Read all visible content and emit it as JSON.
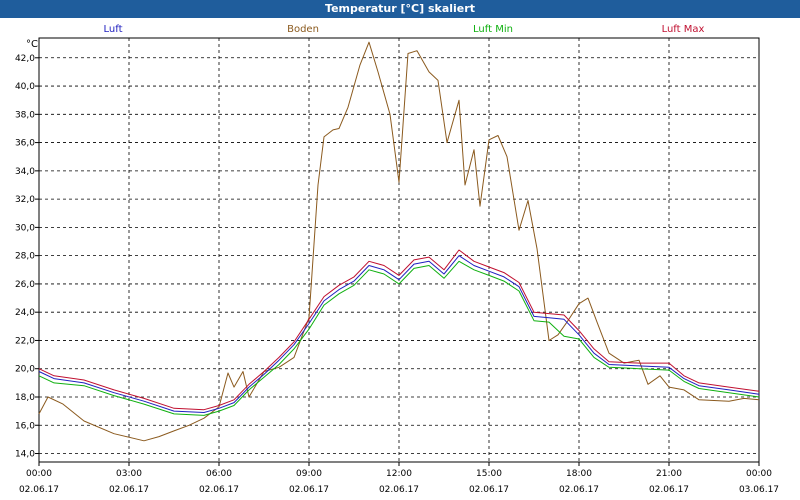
{
  "window": {
    "title": "Temperatur [°C] skaliert"
  },
  "chart_data": {
    "type": "line",
    "title": "Temperatur [°C] skaliert",
    "y_unit": "°C",
    "ylim": [
      13.4,
      43.4
    ],
    "yticks": [
      14,
      16,
      18,
      20,
      22,
      24,
      26,
      28,
      30,
      32,
      34,
      36,
      38,
      40,
      42
    ],
    "ytick_labels": [
      "14,0",
      "16,0",
      "18,0",
      "20,0",
      "22,0",
      "24,0",
      "26,0",
      "28,0",
      "30,0",
      "32,0",
      "34,0",
      "36,0",
      "38,0",
      "40,0",
      "42,0"
    ],
    "xlim_hours": [
      0,
      24
    ],
    "xticks": [
      {
        "time": "00:00",
        "date": "02.06.17"
      },
      {
        "time": "03:00",
        "date": "02.06.17"
      },
      {
        "time": "06:00",
        "date": "02.06.17"
      },
      {
        "time": "09:00",
        "date": "02.06.17"
      },
      {
        "time": "12:00",
        "date": "02.06.17"
      },
      {
        "time": "15:00",
        "date": "02.06.17"
      },
      {
        "time": "18:00",
        "date": "02.06.17"
      },
      {
        "time": "21:00",
        "date": "02.06.17"
      },
      {
        "time": "00:00",
        "date": "03.06.17"
      }
    ],
    "grid": true,
    "legend_position": "top",
    "series": [
      {
        "name": "Luft",
        "color": "#2020c0",
        "points": [
          [
            0,
            19.8
          ],
          [
            0.5,
            19.3
          ],
          [
            1.5,
            19.0
          ],
          [
            2.5,
            18.3
          ],
          [
            3.5,
            17.7
          ],
          [
            4.5,
            17.0
          ],
          [
            5.5,
            16.9
          ],
          [
            6.0,
            17.2
          ],
          [
            6.5,
            17.6
          ],
          [
            7.0,
            18.7
          ],
          [
            7.5,
            19.6
          ],
          [
            8.0,
            20.6
          ],
          [
            8.5,
            21.7
          ],
          [
            9.0,
            23.2
          ],
          [
            9.5,
            24.8
          ],
          [
            10.0,
            25.6
          ],
          [
            10.5,
            26.2
          ],
          [
            11.0,
            27.3
          ],
          [
            11.5,
            27.0
          ],
          [
            12.0,
            26.3
          ],
          [
            12.5,
            27.4
          ],
          [
            13.0,
            27.6
          ],
          [
            13.5,
            26.7
          ],
          [
            14.0,
            28.0
          ],
          [
            14.5,
            27.3
          ],
          [
            15.0,
            26.9
          ],
          [
            15.5,
            26.5
          ],
          [
            16.0,
            25.8
          ],
          [
            16.5,
            23.7
          ],
          [
            17.0,
            23.6
          ],
          [
            17.5,
            23.5
          ],
          [
            18.0,
            22.4
          ],
          [
            18.5,
            21.1
          ],
          [
            19.0,
            20.3
          ],
          [
            20.0,
            20.2
          ],
          [
            21.0,
            20.1
          ],
          [
            21.5,
            19.3
          ],
          [
            22.0,
            18.8
          ],
          [
            23.0,
            18.5
          ],
          [
            24.0,
            18.2
          ]
        ]
      },
      {
        "name": "Boden",
        "color": "#8b5a1e",
        "points": [
          [
            0,
            16.8
          ],
          [
            0.3,
            18.0
          ],
          [
            0.8,
            17.5
          ],
          [
            1.5,
            16.3
          ],
          [
            2.5,
            15.4
          ],
          [
            3.5,
            14.9
          ],
          [
            4.0,
            15.2
          ],
          [
            4.5,
            15.6
          ],
          [
            5.0,
            16.0
          ],
          [
            5.5,
            16.5
          ],
          [
            6.0,
            17.3
          ],
          [
            6.3,
            19.7
          ],
          [
            6.5,
            18.7
          ],
          [
            6.8,
            19.8
          ],
          [
            7.0,
            18.0
          ],
          [
            7.5,
            19.8
          ],
          [
            8.0,
            20.1
          ],
          [
            8.5,
            20.8
          ],
          [
            9.0,
            23.6
          ],
          [
            9.3,
            33.0
          ],
          [
            9.5,
            36.4
          ],
          [
            9.8,
            36.9
          ],
          [
            10.0,
            37.0
          ],
          [
            10.3,
            38.5
          ],
          [
            10.7,
            41.5
          ],
          [
            11.0,
            43.1
          ],
          [
            11.3,
            41.0
          ],
          [
            11.7,
            38.0
          ],
          [
            12.0,
            33.2
          ],
          [
            12.3,
            42.3
          ],
          [
            12.6,
            42.5
          ],
          [
            13.0,
            41.0
          ],
          [
            13.3,
            40.4
          ],
          [
            13.6,
            36.0
          ],
          [
            14.0,
            39.0
          ],
          [
            14.2,
            33.0
          ],
          [
            14.5,
            35.5
          ],
          [
            14.7,
            31.5
          ],
          [
            15.0,
            36.2
          ],
          [
            15.3,
            36.5
          ],
          [
            15.6,
            35.0
          ],
          [
            16.0,
            29.8
          ],
          [
            16.3,
            31.9
          ],
          [
            16.6,
            28.5
          ],
          [
            17.0,
            22.0
          ],
          [
            17.3,
            22.4
          ],
          [
            17.6,
            23.3
          ],
          [
            18.0,
            24.6
          ],
          [
            18.3,
            25.0
          ],
          [
            18.6,
            23.3
          ],
          [
            19.0,
            21.1
          ],
          [
            19.5,
            20.4
          ],
          [
            20.0,
            20.6
          ],
          [
            20.3,
            18.9
          ],
          [
            20.7,
            19.5
          ],
          [
            21.0,
            18.7
          ],
          [
            21.5,
            18.5
          ],
          [
            22.0,
            17.8
          ],
          [
            23.0,
            17.7
          ],
          [
            23.5,
            17.9
          ],
          [
            24.0,
            17.8
          ]
        ]
      },
      {
        "name": "Luft Min",
        "color": "#10b010",
        "points": [
          [
            0,
            19.5
          ],
          [
            0.5,
            19.0
          ],
          [
            1.5,
            18.8
          ],
          [
            2.5,
            18.1
          ],
          [
            3.5,
            17.5
          ],
          [
            4.5,
            16.8
          ],
          [
            5.5,
            16.7
          ],
          [
            6.0,
            17.0
          ],
          [
            6.5,
            17.4
          ],
          [
            7.0,
            18.5
          ],
          [
            7.5,
            19.4
          ],
          [
            8.0,
            20.3
          ],
          [
            8.5,
            21.4
          ],
          [
            9.0,
            22.8
          ],
          [
            9.5,
            24.5
          ],
          [
            10.0,
            25.3
          ],
          [
            10.5,
            25.9
          ],
          [
            11.0,
            27.0
          ],
          [
            11.5,
            26.7
          ],
          [
            12.0,
            26.0
          ],
          [
            12.5,
            27.1
          ],
          [
            13.0,
            27.3
          ],
          [
            13.5,
            26.4
          ],
          [
            14.0,
            27.6
          ],
          [
            14.5,
            27.0
          ],
          [
            15.0,
            26.6
          ],
          [
            15.5,
            26.2
          ],
          [
            16.0,
            25.5
          ],
          [
            16.5,
            23.4
          ],
          [
            17.0,
            23.3
          ],
          [
            17.5,
            22.3
          ],
          [
            18.0,
            22.1
          ],
          [
            18.5,
            20.8
          ],
          [
            19.0,
            20.1
          ],
          [
            20.0,
            20.0
          ],
          [
            21.0,
            19.9
          ],
          [
            21.5,
            19.1
          ],
          [
            22.0,
            18.6
          ],
          [
            23.0,
            18.3
          ],
          [
            24.0,
            18.0
          ]
        ]
      },
      {
        "name": "Luft Max",
        "color": "#c01030",
        "points": [
          [
            0,
            20.0
          ],
          [
            0.5,
            19.5
          ],
          [
            1.5,
            19.2
          ],
          [
            2.5,
            18.5
          ],
          [
            3.5,
            17.9
          ],
          [
            4.5,
            17.2
          ],
          [
            5.5,
            17.1
          ],
          [
            6.0,
            17.4
          ],
          [
            6.5,
            17.8
          ],
          [
            7.0,
            18.9
          ],
          [
            7.5,
            19.8
          ],
          [
            8.0,
            20.8
          ],
          [
            8.5,
            21.9
          ],
          [
            9.0,
            23.5
          ],
          [
            9.5,
            25.1
          ],
          [
            10.0,
            25.9
          ],
          [
            10.5,
            26.5
          ],
          [
            11.0,
            27.6
          ],
          [
            11.5,
            27.3
          ],
          [
            12.0,
            26.6
          ],
          [
            12.5,
            27.7
          ],
          [
            13.0,
            27.9
          ],
          [
            13.5,
            27.0
          ],
          [
            14.0,
            28.4
          ],
          [
            14.5,
            27.6
          ],
          [
            15.0,
            27.2
          ],
          [
            15.5,
            26.8
          ],
          [
            16.0,
            26.1
          ],
          [
            16.5,
            24.0
          ],
          [
            17.0,
            23.9
          ],
          [
            17.5,
            23.8
          ],
          [
            18.0,
            22.7
          ],
          [
            18.5,
            21.4
          ],
          [
            19.0,
            20.5
          ],
          [
            20.0,
            20.4
          ],
          [
            21.0,
            20.4
          ],
          [
            21.5,
            19.5
          ],
          [
            22.0,
            19.0
          ],
          [
            23.0,
            18.7
          ],
          [
            24.0,
            18.4
          ]
        ]
      }
    ]
  }
}
